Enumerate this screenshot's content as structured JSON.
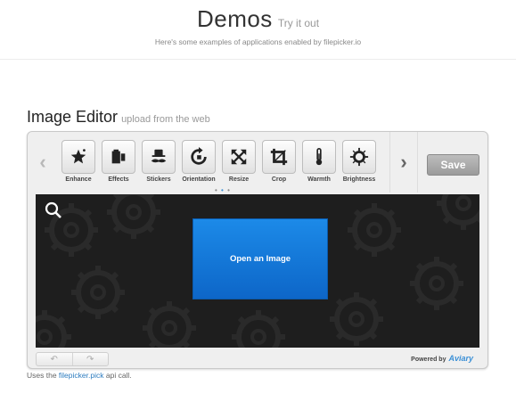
{
  "header": {
    "title": "Demos",
    "title_sub": "Try it out",
    "subtitle": "Here's some examples of applications enabled by filepicker.io"
  },
  "section": {
    "title": "Image Editor",
    "subtitle": "upload from the web"
  },
  "editor": {
    "tools": [
      {
        "label": "Enhance",
        "icon": "enhance-wand-icon"
      },
      {
        "label": "Effects",
        "icon": "effects-icon"
      },
      {
        "label": "Stickers",
        "icon": "mustache-hat-icon"
      },
      {
        "label": "Orientation",
        "icon": "rotate-icon"
      },
      {
        "label": "Resize",
        "icon": "resize-arrows-icon"
      },
      {
        "label": "Crop",
        "icon": "crop-icon"
      },
      {
        "label": "Warmth",
        "icon": "thermometer-icon"
      },
      {
        "label": "Brightness",
        "icon": "sun-icon"
      }
    ],
    "save_label": "Save",
    "open_label": "Open an Image",
    "powered_by": "Powered by",
    "powered_brand": "Aviary",
    "page_dots": 3,
    "active_dot": 1
  },
  "footer_note": {
    "prefix": "Uses the",
    "link": "filepicker.pick",
    "suffix": "api call."
  }
}
